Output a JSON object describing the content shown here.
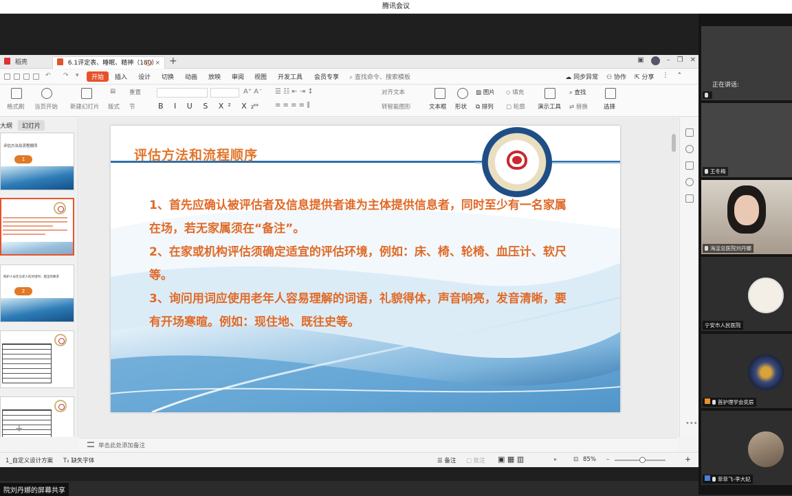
{
  "meeting": {
    "title": "腾讯会议"
  },
  "wps": {
    "tabs": [
      {
        "label": "稻壳"
      },
      {
        "label": "6.1评定表、睡眠、精神（180）"
      }
    ],
    "menu": [
      {
        "label": "开始"
      },
      {
        "label": "插入"
      },
      {
        "label": "设计"
      },
      {
        "label": "切换"
      },
      {
        "label": "动画"
      },
      {
        "label": "放映"
      },
      {
        "label": "审阅"
      },
      {
        "label": "视图"
      },
      {
        "label": "开发工具"
      },
      {
        "label": "会员专享"
      }
    ],
    "search_label": "查找命令、搜索模板",
    "sync_label": "同步异常",
    "collab_label": "协作",
    "share_label": "分享",
    "ribbon": {
      "format_painter": "格式刷",
      "from_current": "当页开始",
      "new_slide": "新建幻灯片",
      "layout": "版式",
      "section": "节",
      "reset": "重置",
      "align_text": "对齐文本",
      "smart_art": "转智能图形",
      "text_box": "文本框",
      "shape": "形状",
      "image": "图片",
      "fill": "填充",
      "arrange": "排列",
      "outline": "轮廓",
      "present_tools": "演示工具",
      "find": "查找",
      "replace": "替换",
      "select": "选择"
    },
    "left_panel": {
      "tab_outline": "大纲",
      "tab_slides": "幻灯片",
      "thumbs": [
        {
          "title": "评估方法及流程顺序",
          "badge": "1"
        },
        {
          "title": "",
          "badge": ""
        },
        {
          "title": "照护人员在与老人的对话时，提出的要求",
          "badge": "2"
        },
        {
          "title": "",
          "badge": ""
        },
        {
          "title": "",
          "badge": ""
        }
      ]
    },
    "slide": {
      "title": "评估方法和流程顺序",
      "lines": [
        "1、首先应确认被评估者及信息提供者谁为主体提供信息者，同时至少有一名家属在场，若无家属须在“备注”。",
        "2、在家或机构评估须确定适宜的评估环境，例如：床、椅、轮椅、血压计、软尺等。",
        "3、询问用词应使用老年人容易理解的词语，礼貌得体，声音响亮，发音清晰，要有开场寒暄。例如：现住地、既往史等。"
      ]
    },
    "notes_placeholder": "单击此处添加备注",
    "status": {
      "design_scheme": "1_自定义设计方案",
      "missing_font": "缺失字体",
      "notes": "备注",
      "annotate": "批注",
      "zoom": "85%"
    }
  },
  "share_label": "院刘丹娜的屏幕共享",
  "participants": {
    "speaking_label": "正在讲话:",
    "tiles": [
      {
        "name": ""
      },
      {
        "name": "王冬梅"
      },
      {
        "name": "海淀总医院刘丹娜"
      },
      {
        "name": "宁安市人民医院"
      },
      {
        "name": "首护理学会奕辰"
      },
      {
        "name": "菲菲飞-李大妃"
      }
    ]
  },
  "colors": {
    "accent": "#e8522a",
    "slide_title": "#e0752a",
    "slide_text": "#e06a28",
    "slide_blue": "#2f6fa8"
  }
}
